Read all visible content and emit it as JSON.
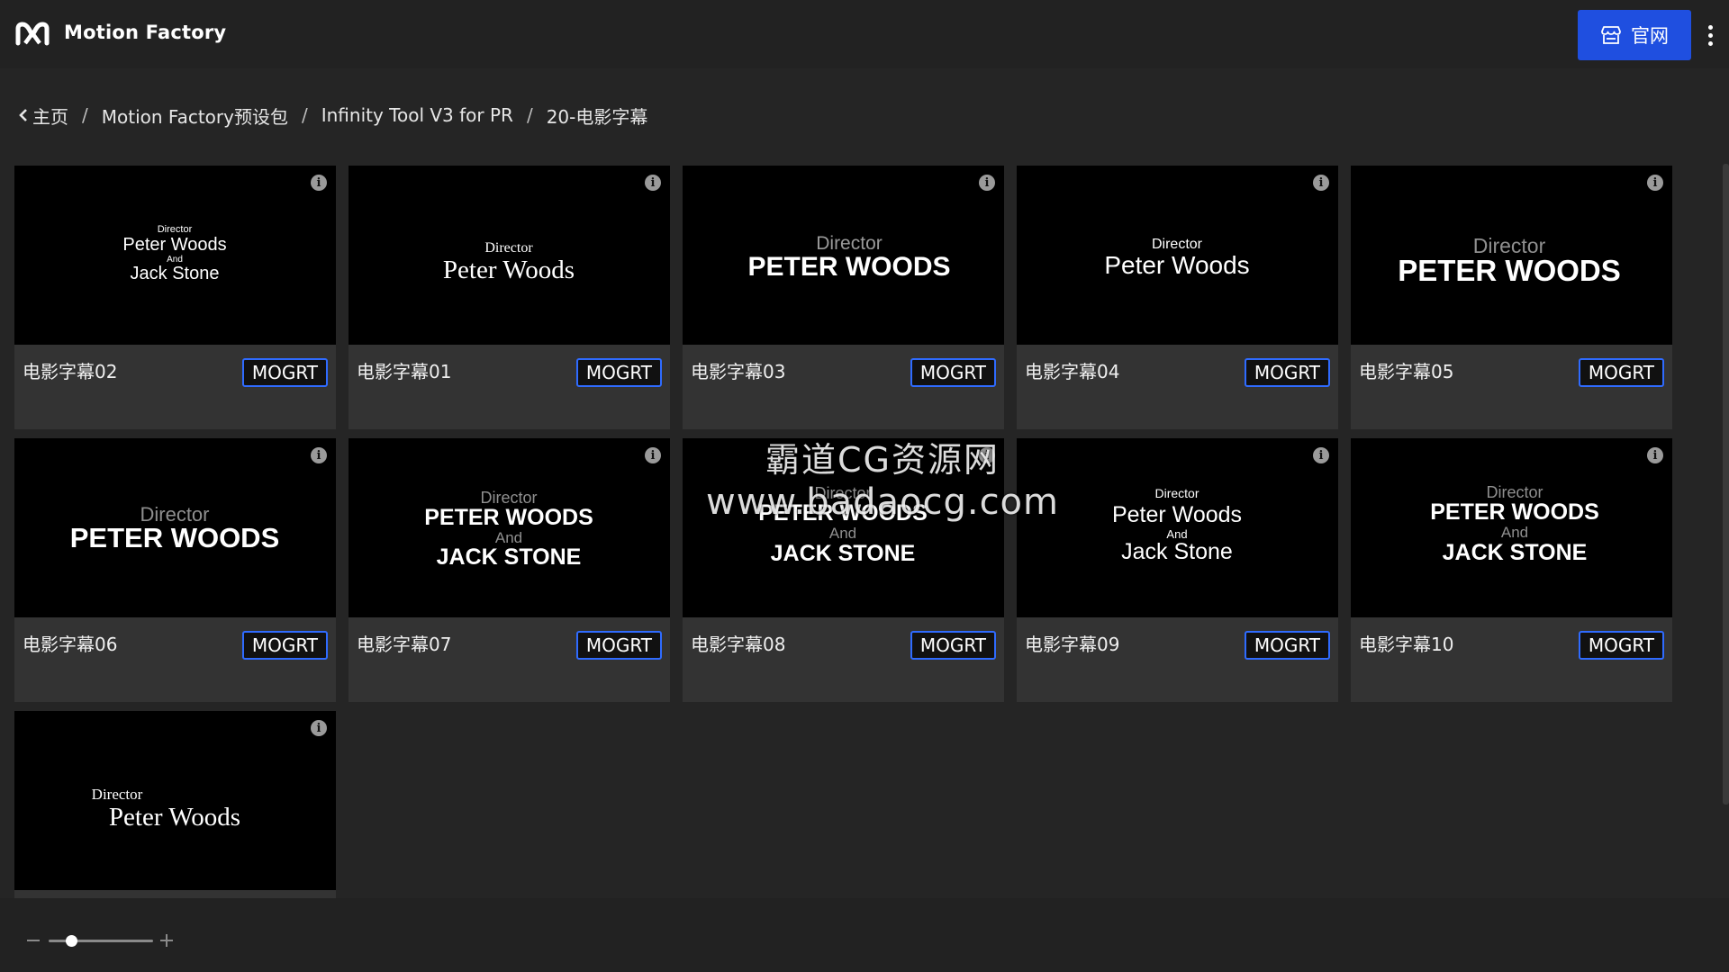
{
  "header": {
    "title": "Motion Factory",
    "site_button_label": "官网",
    "logo_icon": "motion-factory-logo",
    "more_icon": "more-vertical-icon"
  },
  "breadcrumb": [
    {
      "label": "主页"
    },
    {
      "label": "Motion Factory预设包"
    },
    {
      "label": "Infinity Tool V3 for PR"
    },
    {
      "label": "20-电影字幕"
    }
  ],
  "cards": [
    {
      "title": "电影字幕02",
      "badge": "MOGRT",
      "lines": [
        "Director",
        "Peter Woods",
        "And",
        "Jack Stone"
      ]
    },
    {
      "title": "电影字幕01",
      "badge": "MOGRT",
      "lines": [
        "Director",
        "Peter Woods"
      ]
    },
    {
      "title": "电影字幕03",
      "badge": "MOGRT",
      "lines": [
        "Director",
        "PETER WOODS"
      ]
    },
    {
      "title": "电影字幕04",
      "badge": "MOGRT",
      "lines": [
        "Director",
        "Peter Woods"
      ]
    },
    {
      "title": "电影字幕05",
      "badge": "MOGRT",
      "lines": [
        "Director",
        "PETER WOODS"
      ]
    },
    {
      "title": "电影字幕06",
      "badge": "MOGRT",
      "lines": [
        "Director",
        "PETER WOODS"
      ]
    },
    {
      "title": "电影字幕07",
      "badge": "MOGRT",
      "lines": [
        "Director",
        "PETER WOODS",
        "And",
        "JACK STONE"
      ]
    },
    {
      "title": "电影字幕08",
      "badge": "MOGRT",
      "lines": [
        "Director",
        "PETER WOODS",
        "And",
        "JACK STONE"
      ]
    },
    {
      "title": "电影字幕09",
      "badge": "MOGRT",
      "lines": [
        "Director",
        "Peter Woods",
        "And",
        "Jack Stone"
      ]
    },
    {
      "title": "电影字幕10",
      "badge": "MOGRT",
      "lines": [
        "Director",
        "PETER WOODS",
        "And",
        "JACK STONE"
      ]
    },
    {
      "title": "",
      "badge": "",
      "lines": [
        "Director",
        "Peter Woods"
      ]
    }
  ],
  "watermark": {
    "line1": "霸道CG资源网",
    "line2": "www.badaocg.com"
  },
  "colors": {
    "accent": "#1f4fe0",
    "badge_border": "#2f6bff"
  }
}
